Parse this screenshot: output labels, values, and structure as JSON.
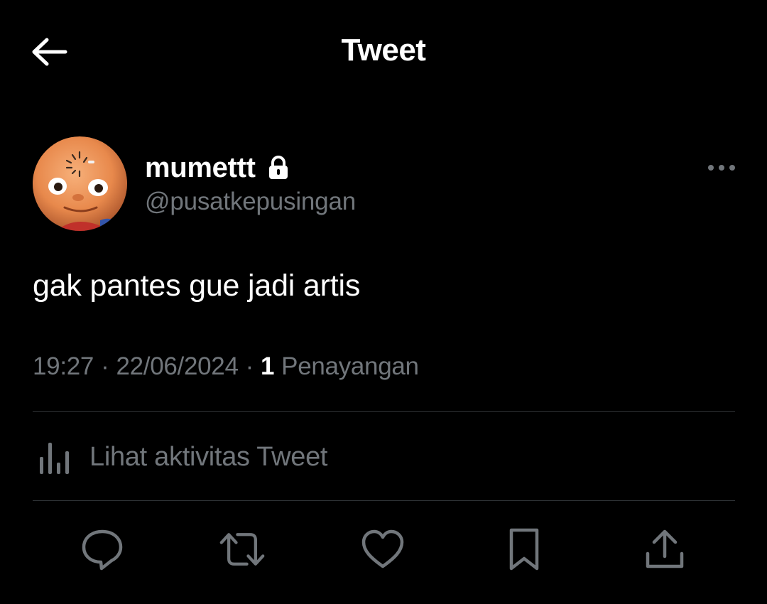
{
  "header": {
    "title": "Tweet",
    "back_icon": "arrow-left-icon"
  },
  "author": {
    "display_name": "mumettt",
    "handle": "@pusatkepusingan",
    "protected_icon": "lock-icon",
    "avatar_icon": "avatar-cartoon-face",
    "more_icon": "more-horizontal-icon"
  },
  "tweet": {
    "text": "gak pantes gue jadi artis",
    "time": "19:27",
    "date": "22/06/2024",
    "separator": "·",
    "views_count": "1",
    "views_label": "Penayangan"
  },
  "activity": {
    "label": "Lihat aktivitas Tweet",
    "icon": "analytics-bars-icon"
  },
  "actions": [
    {
      "name": "reply",
      "icon": "reply-bubble-icon"
    },
    {
      "name": "retweet",
      "icon": "retweet-icon"
    },
    {
      "name": "like",
      "icon": "heart-icon"
    },
    {
      "name": "bookmark",
      "icon": "bookmark-icon"
    },
    {
      "name": "share",
      "icon": "share-upload-icon"
    }
  ],
  "colors": {
    "background": "#000000",
    "primary_text": "#ffffff",
    "secondary_text": "#71767b",
    "divider": "#2f3336"
  }
}
